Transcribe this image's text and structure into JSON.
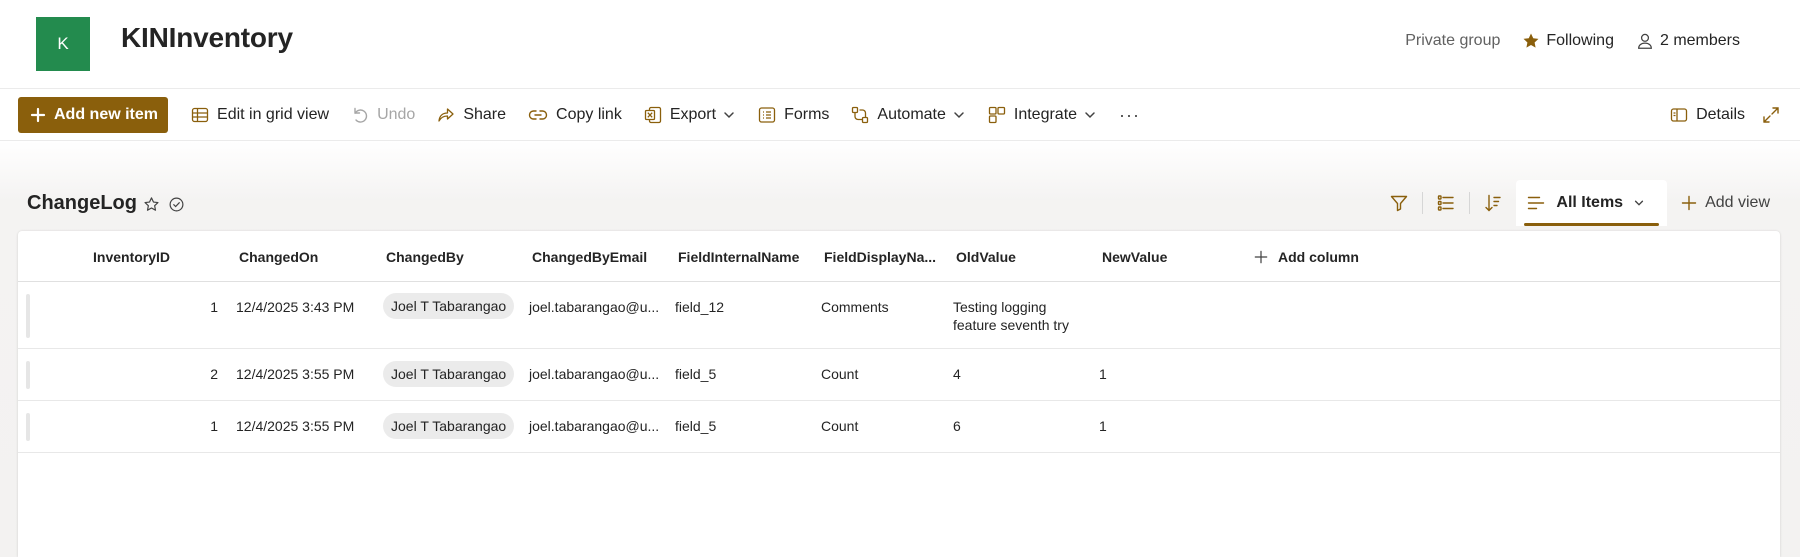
{
  "site": {
    "logo_letter": "K",
    "title": "KINInventory",
    "private_label": "Private group",
    "following_label": "Following",
    "members_label": "2 members",
    "logo_color": "#238b4e",
    "accent_color": "#8a5f0c"
  },
  "toolbar": {
    "add_new_item": "Add new item",
    "edit_grid": "Edit in grid view",
    "undo": "Undo",
    "share": "Share",
    "copy_link": "Copy link",
    "export": "Export",
    "forms": "Forms",
    "automate": "Automate",
    "integrate": "Integrate",
    "more": "···",
    "details": "Details"
  },
  "list": {
    "title": "ChangeLog",
    "view_name": "All Items",
    "add_view": "Add view"
  },
  "columns": [
    "InventoryID",
    "ChangedOn",
    "ChangedBy",
    "ChangedByEmail",
    "FieldInternalName",
    "FieldDisplayNa...",
    "OldValue",
    "NewValue"
  ],
  "add_column": "Add column",
  "rows": [
    {
      "inventory_id": "1",
      "changed_on": "12/4/2025 3:43 PM",
      "changed_by": "Joel T Tabarangao",
      "email": "joel.tabarangao@u...",
      "field_internal": "field_12",
      "field_display": "Comments",
      "old_value_line1": "Testing logging",
      "old_value_line2": "feature seventh try",
      "new_value": ""
    },
    {
      "inventory_id": "2",
      "changed_on": "12/4/2025 3:55 PM",
      "changed_by": "Joel T Tabarangao",
      "email": "joel.tabarangao@u...",
      "field_internal": "field_5",
      "field_display": "Count",
      "old_value_line1": "4",
      "old_value_line2": "",
      "new_value": "1"
    },
    {
      "inventory_id": "1",
      "changed_on": "12/4/2025 3:55 PM",
      "changed_by": "Joel T Tabarangao",
      "email": "joel.tabarangao@u...",
      "field_internal": "field_5",
      "field_display": "Count",
      "old_value_line1": "6",
      "old_value_line2": "",
      "new_value": "1"
    }
  ],
  "icons": {
    "title_favorite": "star-icon",
    "title_status": "check-circle-icon",
    "filter": "filter-icon",
    "group": "list-settings-icon",
    "sort": "sort-icon",
    "view": "view-lines-icon",
    "add_view": "plus-icon",
    "details": "details-panel-icon",
    "expand": "expand-icon"
  }
}
